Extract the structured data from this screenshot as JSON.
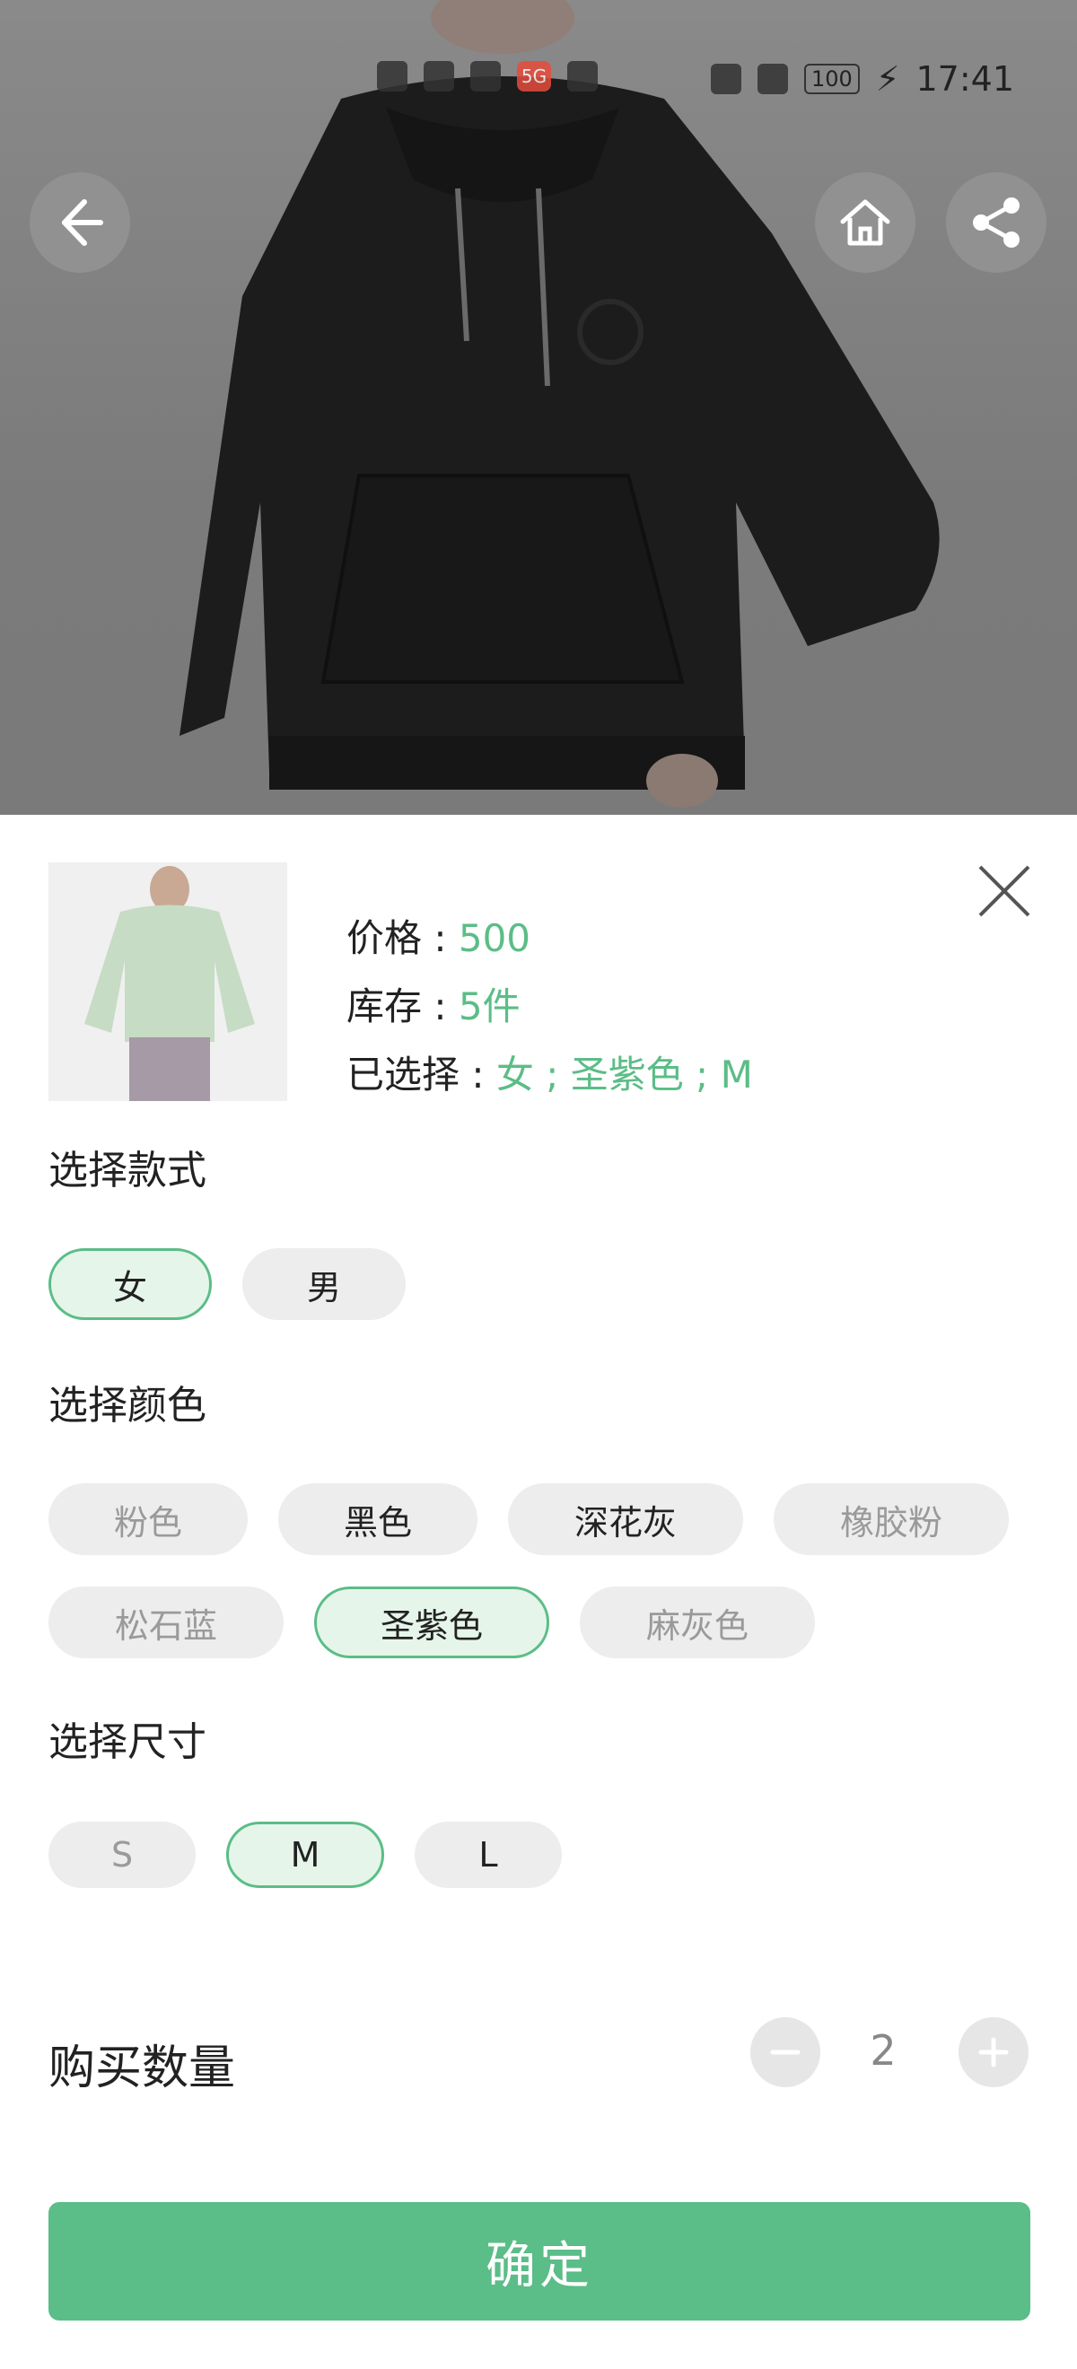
{
  "status_bar": {
    "left_icons": [
      "hd-icon",
      "signal-4g-icon",
      "wifi-icon",
      "5g-icon",
      "qq-icon"
    ],
    "battery": "100",
    "time": "17:41",
    "right_icons": [
      "nfc-icon",
      "alarm-icon",
      "battery-icon",
      "charging-icon"
    ]
  },
  "hero": {
    "buttons": [
      "back-arrow-icon",
      "home-icon",
      "share-icon"
    ]
  },
  "sheet": {
    "price_label": "价格 : ",
    "price_value": "500",
    "stock_label": "库存 : ",
    "stock_value": "5件",
    "selected_label": "已选择 : ",
    "selected_value": "女 ; 圣紫色 ; M",
    "style_section": {
      "title": "选择款式",
      "options": [
        {
          "label": "女",
          "state": "selected"
        },
        {
          "label": "男",
          "state": "normal"
        }
      ]
    },
    "color_section": {
      "title": "选择颜色",
      "options": [
        {
          "label": "粉色",
          "state": "disabled"
        },
        {
          "label": "黑色",
          "state": "normal"
        },
        {
          "label": "深花灰",
          "state": "normal"
        },
        {
          "label": "橡胶粉",
          "state": "disabled"
        },
        {
          "label": "松石蓝",
          "state": "disabled"
        },
        {
          "label": "圣紫色",
          "state": "selected"
        },
        {
          "label": "麻灰色",
          "state": "disabled"
        }
      ]
    },
    "size_section": {
      "title": "选择尺寸",
      "options": [
        {
          "label": "S",
          "state": "disabled"
        },
        {
          "label": "M",
          "state": "selected"
        },
        {
          "label": "L",
          "state": "normal"
        }
      ]
    },
    "quantity": {
      "label": "购买数量",
      "value": "2"
    },
    "confirm_label": "确定"
  },
  "colors": {
    "accent": "#5bbd87",
    "chip_bg": "#ededed",
    "chip_selected_bg": "#e6f5ea",
    "overlay": "#7a7a7a"
  }
}
